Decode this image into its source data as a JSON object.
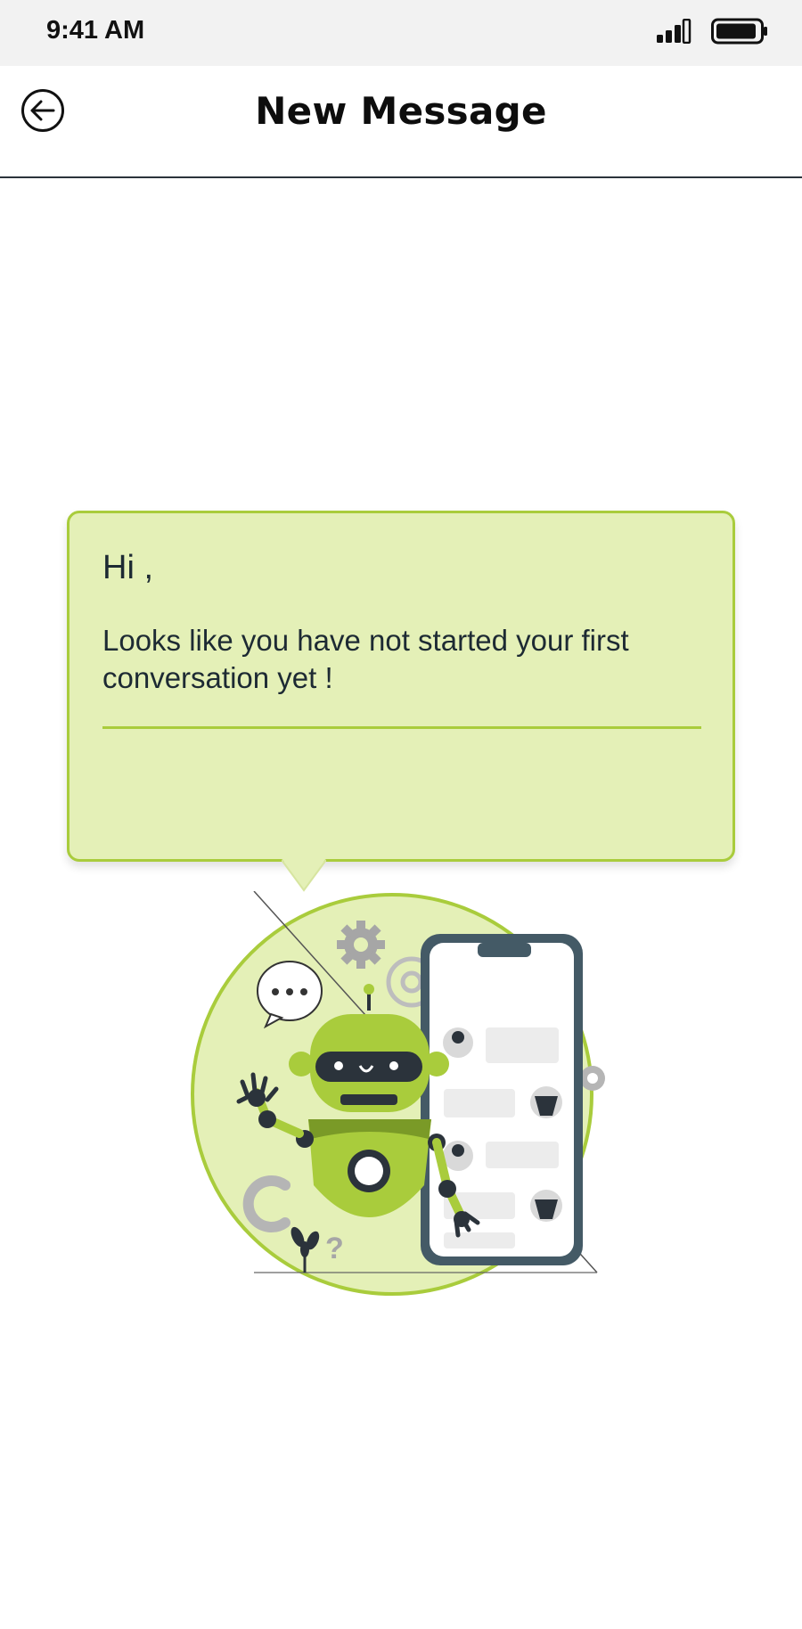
{
  "status_bar": {
    "time": "9:41 AM"
  },
  "header": {
    "title": "New Message"
  },
  "empty_state": {
    "greeting": "Hi ,",
    "message": "Looks like you have not started your first conversation yet !"
  },
  "colors": {
    "accent": "#a9cc3c",
    "bubble_fill": "#e4f0b7",
    "dark": "#2b333b"
  }
}
